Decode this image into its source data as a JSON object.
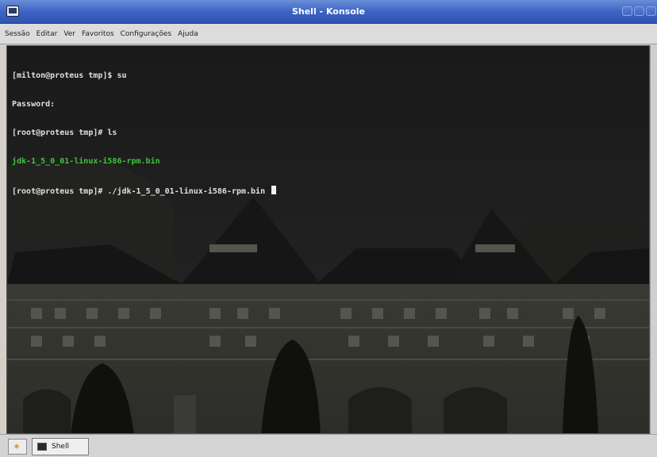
{
  "window": {
    "title": "Shell - Konsole"
  },
  "menubar": {
    "items": [
      "Sessão",
      "Editar",
      "Ver",
      "Favoritos",
      "Configurações",
      "Ajuda"
    ]
  },
  "terminal": {
    "lines": [
      {
        "text": "[milton@proteus tmp]$ su",
        "color": "#e0e0e0"
      },
      {
        "text": "Password:",
        "color": "#e0e0e0"
      },
      {
        "text": "[root@proteus tmp]# ls",
        "color": "#e0e0e0"
      },
      {
        "text": "jdk-1_5_0_01-linux-i586-rpm.bin",
        "color": "#3ec43e"
      },
      {
        "text": "[root@proteus tmp]# ./jdk-1_5_0_01-linux-i586-rpm.bin ",
        "color": "#e0e0e0"
      }
    ]
  },
  "tabbar": {
    "new_tab_icon": "new-session-star-icon",
    "session_label": "Shell"
  },
  "colors": {
    "titlebar": "#3d64c4",
    "terminal_bg": "#1c1c1c",
    "prompt_text": "#e0e0e0",
    "file_text": "#3ec43e"
  }
}
